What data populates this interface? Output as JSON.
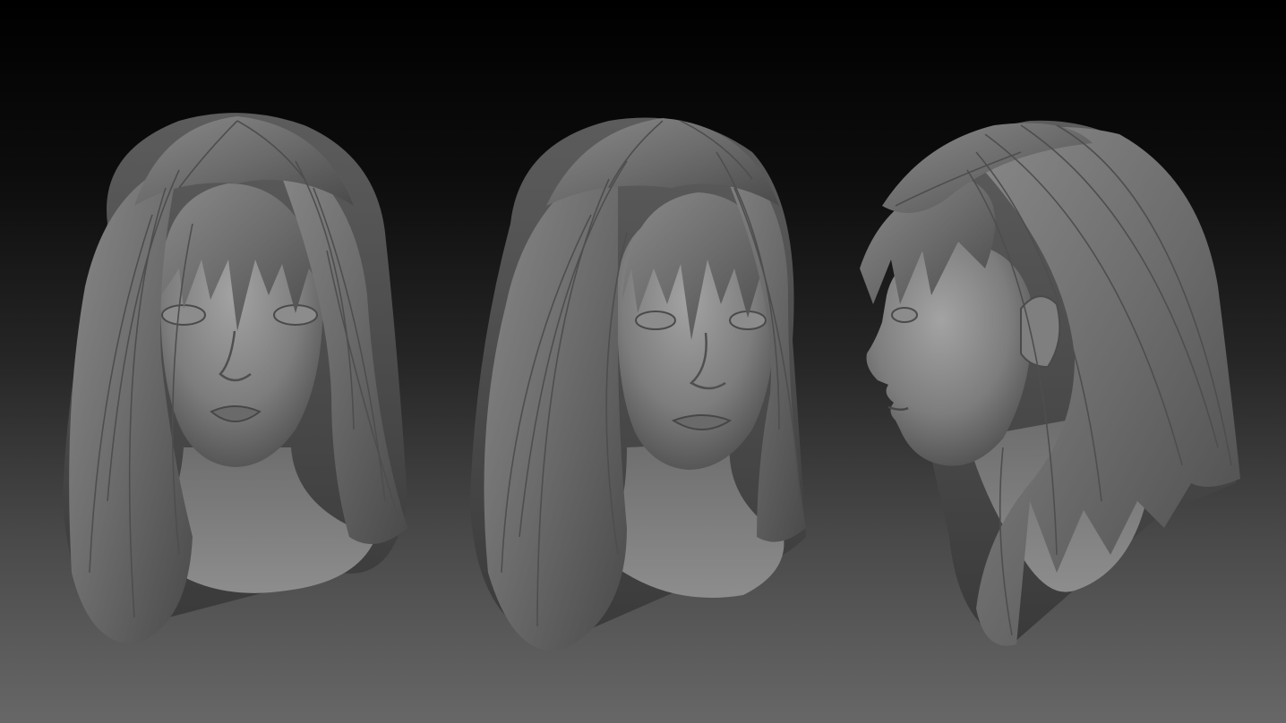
{
  "scene": {
    "description_tags": [
      "front-view-head",
      "three-quarter-view-head",
      "side-view-head"
    ],
    "colors": {
      "background_top": "#000000",
      "background_bottom": "#676767",
      "clay_light": "#9a9a9a",
      "clay_mid": "#6f6f6f",
      "clay_dark": "#3c3c3c"
    },
    "views": [
      {
        "id": "front"
      },
      {
        "id": "three-quarter"
      },
      {
        "id": "profile"
      }
    ]
  }
}
